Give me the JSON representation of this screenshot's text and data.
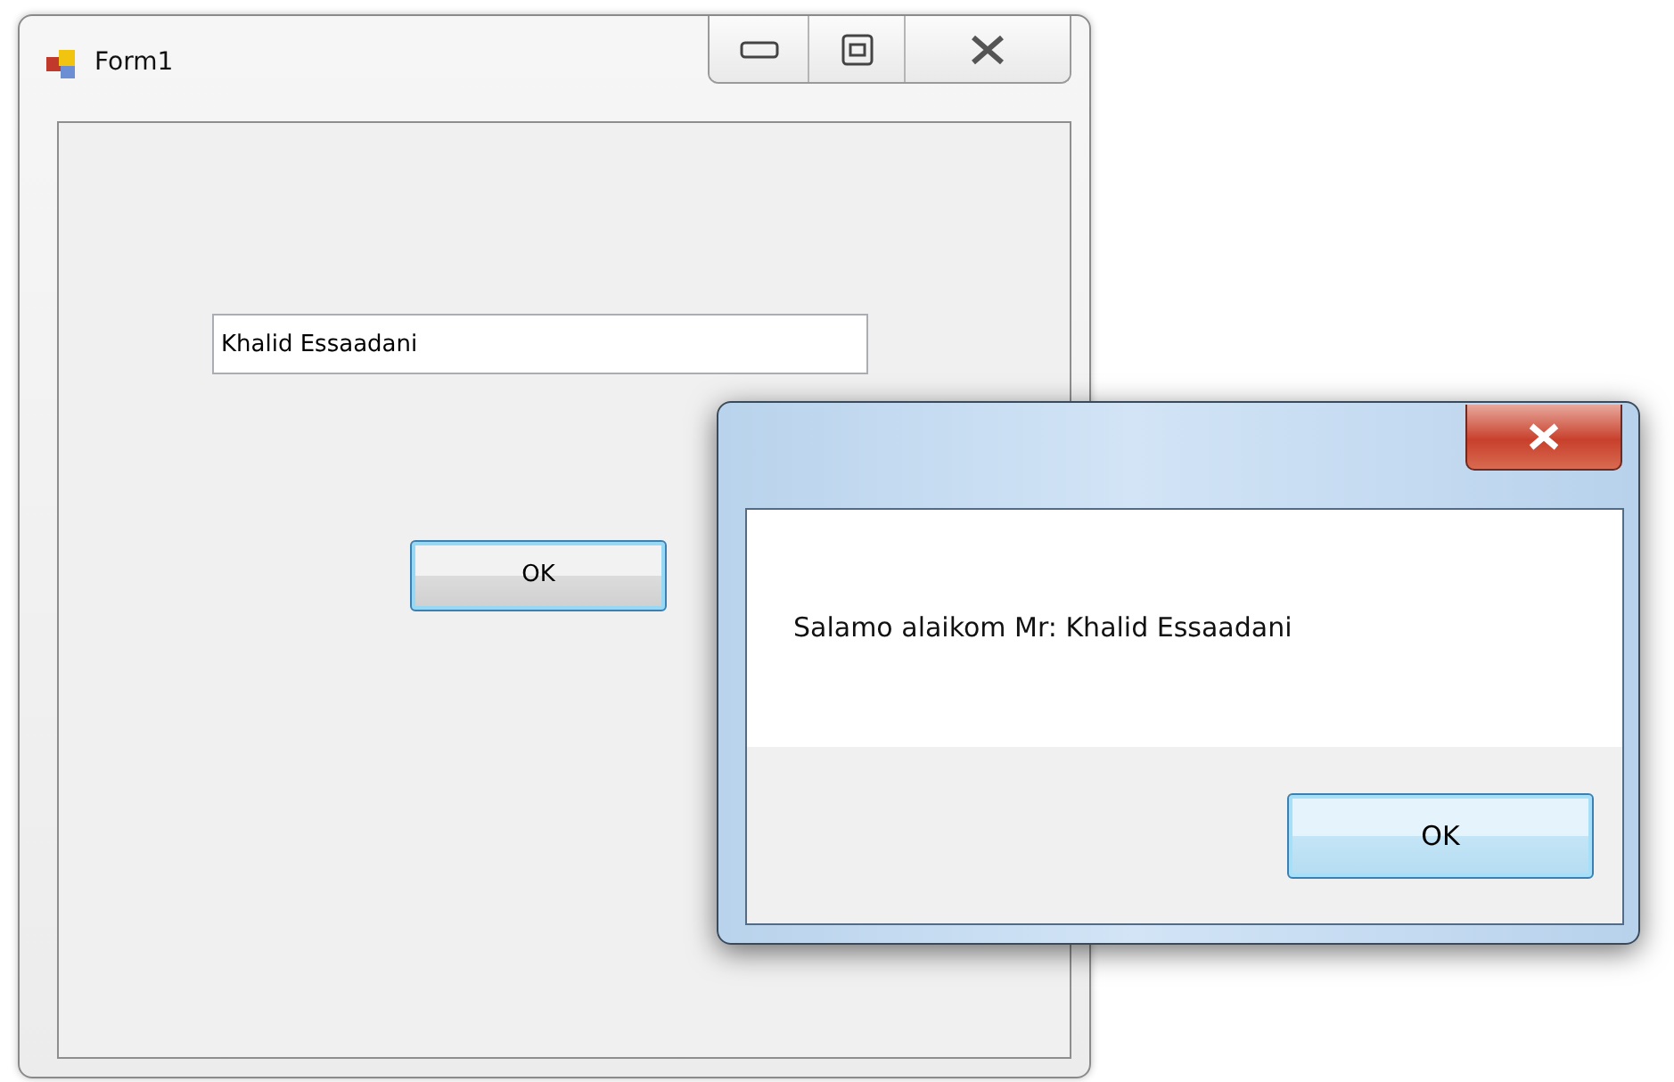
{
  "main_window": {
    "title": "Form1",
    "text_field": {
      "value": "Khalid Essaadani"
    },
    "button": "OK"
  },
  "message_box": {
    "message": "Salamo alaikom Mr: Khalid Essaadani",
    "button": "OK"
  }
}
